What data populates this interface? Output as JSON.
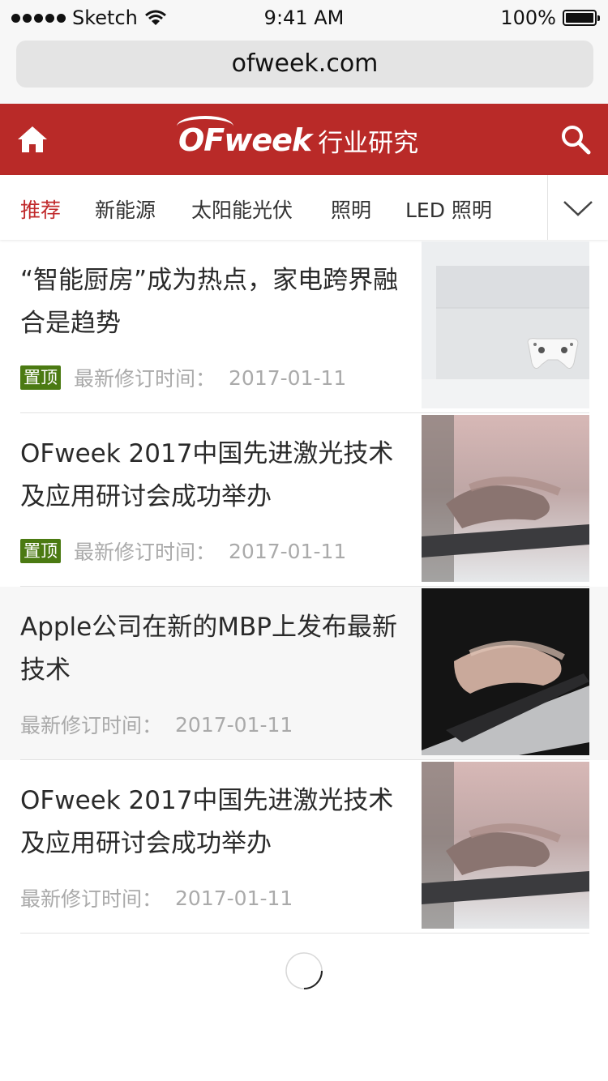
{
  "status": {
    "carrier": "Sketch",
    "time": "9:41 AM",
    "battery": "100%"
  },
  "browser": {
    "url": "ofweek.com"
  },
  "header": {
    "brand": "OFweek",
    "subtitle": "行业研究"
  },
  "tabs": [
    "推荐",
    "新能源",
    "太阳能光伏",
    "照明",
    "LED 照明"
  ],
  "articles": [
    {
      "title": "“智能厨房”成为热点，家电跨界融合是趋势",
      "badge": "置顶",
      "meta_label": "最新修订时间：",
      "date": "2017-01-11"
    },
    {
      "title": "OFweek 2017中国先进激光技术及应用研讨会成功举办",
      "badge": "置顶",
      "meta_label": "最新修订时间：",
      "date": "2017-01-11"
    },
    {
      "title": "Apple公司在新的MBP上发布最新技术",
      "badge": "",
      "meta_label": "最新修订时间：",
      "date": "2017-01-11"
    },
    {
      "title": "OFweek 2017中国先进激光技术及应用研讨会成功举办",
      "badge": "",
      "meta_label": "最新修订时间：",
      "date": "2017-01-11"
    }
  ],
  "colors": {
    "brand_red": "#b92a28",
    "active_tab": "#c0282a",
    "badge_green": "#4b7a12"
  }
}
